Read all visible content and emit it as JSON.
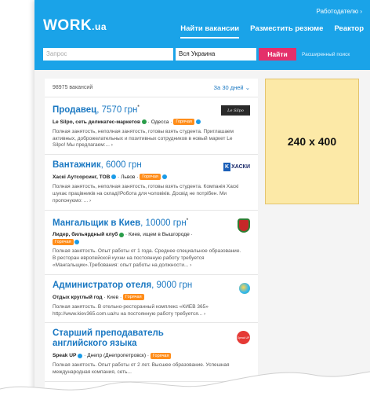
{
  "header": {
    "logo_main": "WORK",
    "logo_tld": ".ua",
    "employers_link": "Работодателю ›",
    "nav": [
      "Найти вакансии",
      "Разместить резюме",
      "Реактор"
    ],
    "search_placeholder": "Запрос",
    "region_value": "Вся Украина",
    "find_label": "Найти",
    "advanced_label": "Расширенный поиск"
  },
  "results": {
    "count": "98975 вакансий",
    "period": "За 30 дней ⌄"
  },
  "vacancies": [
    {
      "title": "Продавец",
      "salary": ", 7570 грн",
      "sup": "*",
      "company": "Le Silpo, сеть деликатес-маркетов",
      "city": "Одесса",
      "badge": "Горячая",
      "desc": "Полная занятость, неполная занятость, готовы взять студента. Приглашаем активных, доброжелательных и позитивных сотрудников в новый маркет Le Silpo! Мы предлагаем:... ›",
      "logo_text": "Le Silpo"
    },
    {
      "title": "Вантажник",
      "salary": ", 6000 грн",
      "sup": "",
      "company": "Хаскі Аутсорсинг, ТОВ",
      "city": "Львов",
      "badge": "Горячая",
      "desc": "Полная занятость, неполная занятость, готовы взять студента. Компанія Хаскі шукає працівників на складі!Робота для чоловіків. Досвід не потрібен. Ми пропонуємо: ... ›",
      "logo_text": "ХАСКИ"
    },
    {
      "title": "Мангальщик в Киев",
      "salary": ", 10000 грн",
      "sup": "*",
      "company": "Лидер, бильярдный клуб",
      "city": "Киев, ищем в Вышгороде",
      "badge": "Горячая",
      "desc": "Полная занятость. Опыт работы от 1 года. Среднее специальное образование. В ресторан европейской кухни на постоянную работу требуется «Мангальщик».Требования: опыт работы на должности... ›",
      "logo_text": ""
    },
    {
      "title": "Администратор отеля",
      "salary": ", 9000 грн",
      "sup": "",
      "company": "Отдых круглый год",
      "city": "Киев",
      "badge": "Горячая",
      "desc": "Полная занятость. В отельно-ресторанный комплекс «КИЕВ 365» http://www.kiev365.com.ua/ru на постоянную работу требуется... ›",
      "logo_text": ""
    },
    {
      "title": "Старший преподаватель английского языка",
      "salary": "",
      "sup": "",
      "company": "Speak UP",
      "city": "Днепр (Днепропетровск)",
      "badge": "Горячая",
      "desc": "Полная занятость. Опыт работы от 2 лет. Высшее образование. Успешная международная компания, сеть...",
      "logo_text": "Speak UP"
    }
  ],
  "ad": {
    "label": "240 x 400"
  },
  "colors": {
    "brand": "#1aa3e8",
    "find": "#e4306a",
    "hot": "#ff8d1a",
    "link": "#1a78c2"
  }
}
